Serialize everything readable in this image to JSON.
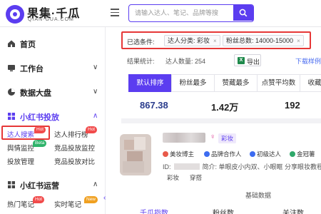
{
  "brand": {
    "title": "果集·千瓜",
    "subtitle": "QIAN-GUA.COM",
    "accent": "#5b3df0"
  },
  "search": {
    "placeholder": "请输入达人、笔记、品牌等搜"
  },
  "sidebar": {
    "items": [
      {
        "label": "首页",
        "icon": "home-icon"
      },
      {
        "label": "工作台",
        "icon": "workbench-icon",
        "chevron": "∨"
      },
      {
        "label": "数据大盘",
        "icon": "dashboard-icon",
        "chevron": "∨"
      },
      {
        "label": "小红书投放",
        "icon": "grid-icon",
        "chevron": "∧"
      },
      {
        "label": "小红书运营",
        "icon": "operation-icon",
        "chevron": "∧"
      }
    ],
    "placement_subs": [
      "达人搜索",
      "达人排行榜",
      "舆情监控",
      "竞品投放监控",
      "投放管理",
      "竞品投放对比"
    ],
    "operation_subs": [
      "热门笔记",
      "实时笔记"
    ],
    "badges": {
      "hot": "Hot",
      "beta": "Beta",
      "new": "New"
    }
  },
  "filters": {
    "label": "已选条件:",
    "chips": [
      "达人分类: 彩妆",
      "粉丝总数: 14000-15000"
    ]
  },
  "results": {
    "stats_label": "结果统计:",
    "count_text": "达人数量: 254",
    "export_label": "导出",
    "download_link": "下载样例"
  },
  "sort_tabs": [
    "默认排序",
    "粉丝最多",
    "赞藏最多",
    "点赞平均数",
    "收藏平均"
  ],
  "summary_values": [
    "867.38",
    "1.42万",
    "192"
  ],
  "profile": {
    "tag": "彩妆",
    "attributes": [
      "美妆博主",
      "品牌合作人",
      "初级达人",
      "金冠薯"
    ],
    "id_label": "ID:",
    "intro": "简介: 单眼皮小内双、小眼眶 分享眼妆教程 |",
    "categories": [
      "彩妆",
      "穿搭"
    ]
  },
  "section_title": "基础数据",
  "metric_headers": [
    "千瓜指数",
    "粉丝数",
    "关注数"
  ]
}
